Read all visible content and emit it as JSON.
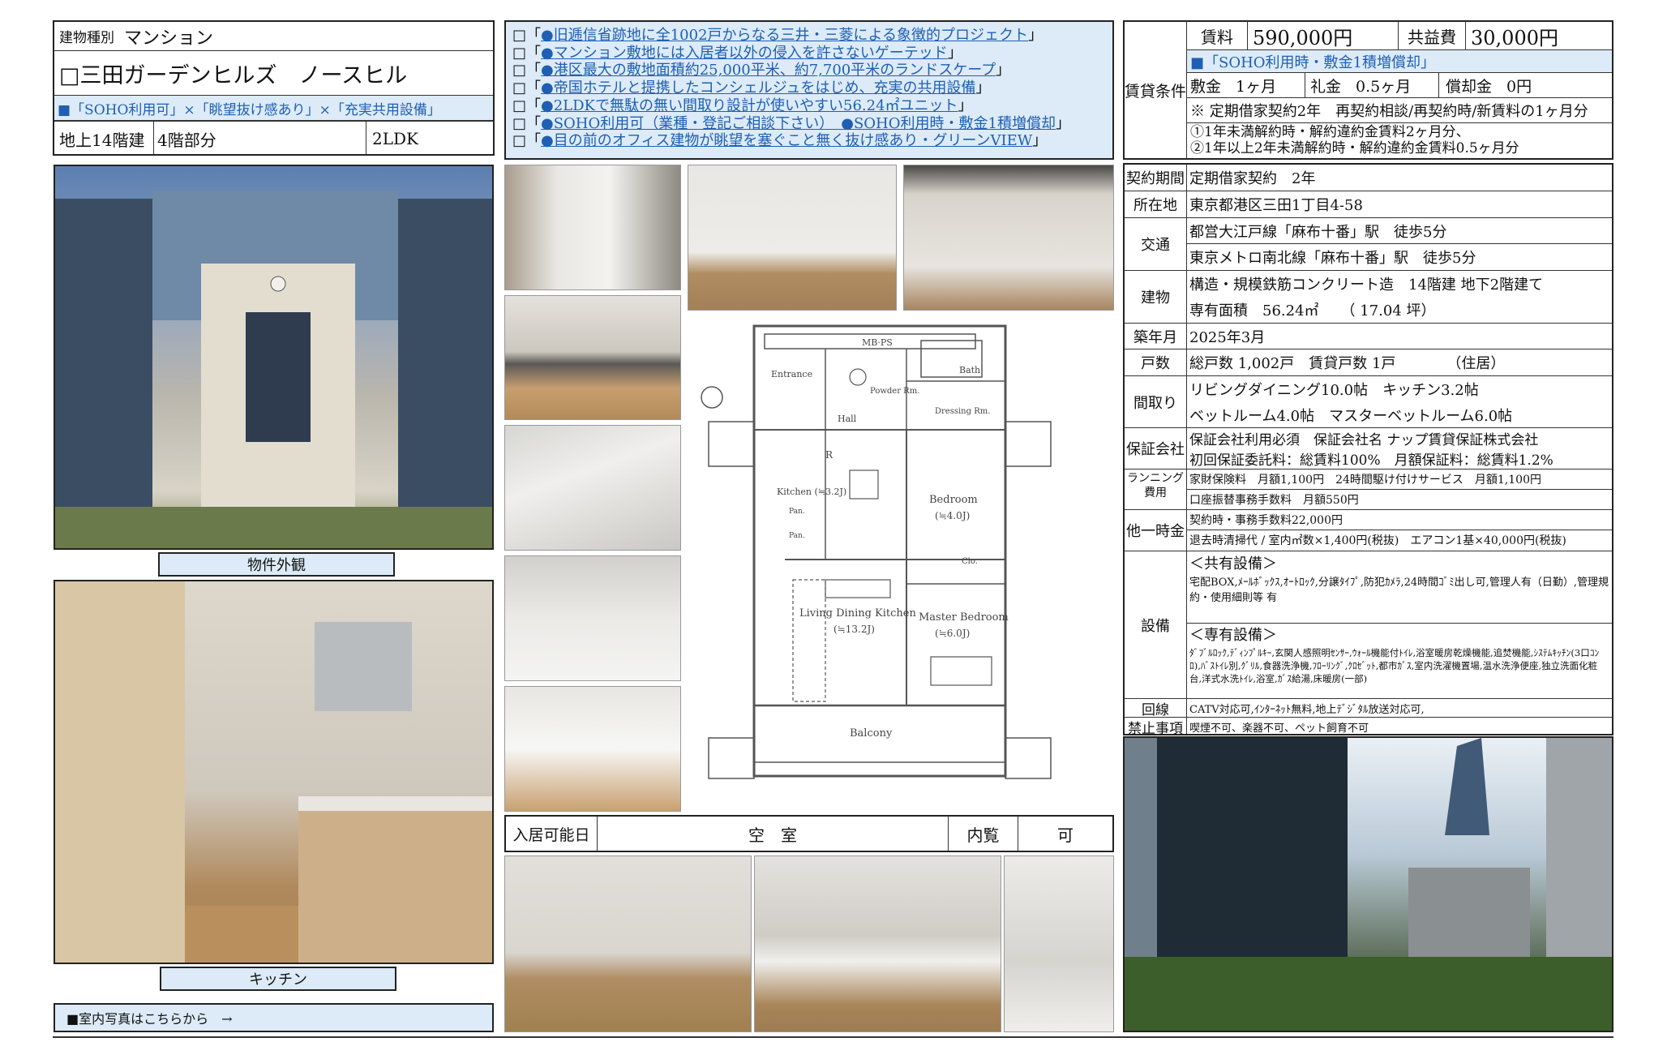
{
  "header": {
    "building_type_label": "建物種別",
    "building_type": "マンション",
    "property_name": "□三田ガーデンヒルズ　ノースヒル",
    "tagline": "■「SOHO利用可」×「眺望抜け感あり」×「充実共用設備」",
    "floors": "地上14階建",
    "unit_floor": "4階部分",
    "layout": "2LDK"
  },
  "features": [
    {
      "prefix": "□「",
      "text": "●旧逓信省跡地に全1002戸からなる三井・三菱による象徴的プロジェクト",
      "suffix": "」"
    },
    {
      "prefix": "□「",
      "text": "●マンション敷地には入居者以外の侵入を許さないゲーテッド",
      "suffix": "」"
    },
    {
      "prefix": "□「",
      "text": "●港区最大の敷地面積約25,000平米、約7,700平米のランドスケープ",
      "suffix": "」"
    },
    {
      "prefix": "□「",
      "text": "●帝国ホテルと提携したコンシェルジュをはじめ、充実の共用設備",
      "suffix": "」"
    },
    {
      "prefix": "□「",
      "text": "●2LDKで無駄の無い間取り設計が使いやすい56.24㎡ユニット",
      "suffix": "」"
    },
    {
      "prefix": "□「",
      "text": "●SOHO利用可（業種・登記ご相談下さい）　●SOHO利用時・敷金1積増償却",
      "suffix": "」"
    },
    {
      "prefix": "□「",
      "text": "●目の前のオフィス建物が眺望を塞ぐこと無く抜け感あり・グリーンVIEW",
      "suffix": "」"
    }
  ],
  "rent": {
    "section_label": "賃貸条件",
    "rent_label": "賃料",
    "rent_value": "590,000円",
    "common_label": "共益費",
    "common_value": "30,000円",
    "soho_note": "■「SOHO利用時・敷金1積増償却」",
    "deposit_label": "敷金",
    "deposit_value": "1ヶ月",
    "key_money_label": "礼金",
    "key_money_value": "0.5ヶ月",
    "amortization_label": "償却金",
    "amortization_value": "0円",
    "contract_note": "※ 定期借家契約2年　再契約相談/再契約時/新賃料の1ヶ月分",
    "penalty_1": "①1年未満解約時・解約違約金賃料2ヶ月分、",
    "penalty_2": "②1年以上2年未満解約時・解約違約金賃料0.5ヶ月分"
  },
  "details": {
    "contract_label": "契約期間",
    "contract_value": "定期借家契約　2年",
    "address_label": "所在地",
    "address_value": "東京都港区三田1丁目4-58",
    "transit_label": "交通",
    "transit_1": "都営大江戸線「麻布十番」駅　徒歩5分",
    "transit_2": "東京メトロ南北線「麻布十番」駅　徒歩5分",
    "building_label": "建物",
    "building_1": "構造・規模鉄筋コンクリート造　14階建 地下2階建て",
    "building_2": "専有面積　56.24㎡　　（ 17.04 坪）",
    "built_label": "築年月",
    "built_value": "2025年3月",
    "units_label": "戸数",
    "units_value": "総戸数 1,002戸　賃貸戸数 1戸　　　　（住居）",
    "rooms_label": "間取り",
    "rooms_1": "リビングダイニング10.0帖　キッチン3.2帖",
    "rooms_2": "ベットルーム4.0帖　マスターベットルーム6.0帖",
    "guarantee_label": "保証会社",
    "guarantee_1": "保証会社利用必須　保証会社名 ナップ賃貸保証株式会社",
    "guarantee_2": "初回保証委託料：総賃料100%　月額保証料：総賃料1.2%",
    "running_label_1": "ランニング",
    "running_label_2": "費用",
    "running_1": "家財保険料　月額1,100円　24時間駆け付けサービス　月額1,100円",
    "running_2": "口座振替事務手数料　月額550円",
    "lump_label": "他一時金",
    "lump_1": "契約時・事務手数料22,000円",
    "lump_2": "退去時清掃代 / 室内㎡数×1,400円(税抜)　エアコン1基×40,000円(税抜)",
    "equipment_label": "設備",
    "shared_heading": "＜共有設備＞",
    "shared_text": "宅配BOX,ﾒｰﾙﾎﾞｯｸｽ,ｵｰﾄﾛｯｸ,分譲ﾀｲﾌﾟ,防犯ｶﾒﾗ,24時間ｺﾞﾐ出し可,管理人有（日勤）,管理規約・使用細則等 有",
    "private_heading": "＜専有設備＞",
    "private_text": "ﾀﾞﾌﾞﾙﾛｯｸ,ﾃﾞｨﾝﾌﾟﾙｷｰ,玄関人感照明ｾﾝｻｰ,ｳｫｰﾙ機能付ﾄｲﾚ,浴室暖房乾燥機能,追焚機能,ｼｽﾃﾑｷｯﾁﾝ(3口ｺﾝﾛ),ﾊﾞｽﾄｲﾚ別,ｸﾞﾘﾙ,食器洗浄機,ﾌﾛｰﾘﾝｸﾞ,ｸﾛｾﾞｯﾄ,都市ｶﾞｽ,室内洗濯機置場,温水洗浄便座,独立洗面化粧台,洋式水洗ﾄｲﾚ,浴室,ｶﾞｽ給湯,床暖房(一部)",
    "line_label": "回線",
    "line_value": "CATV対応可,ｲﾝﾀｰﾈｯﾄ無料,地上ﾃﾞｼﾞﾀﾙ放送対応可,",
    "prohibited_label": "禁止事項",
    "prohibited_value": "喫煙不可、楽器不可、ペット飼育不可"
  },
  "photos": {
    "exterior_caption": "物件外観",
    "kitchen_caption": "キッチン",
    "interior_link": "■室内写真はこちらから　→"
  },
  "move_in": {
    "label": "入居可能日",
    "value": "空　室",
    "viewing_label": "内覧",
    "viewing_value": "可"
  },
  "floorplan": {
    "labels": {
      "mbps": "MB·PS",
      "entrance": "Entrance",
      "powder": "Powder Rm.",
      "bath": "Bath",
      "hall": "Hall",
      "dressing": "Dressing Rm.",
      "r": "R",
      "kitchen": "Kitchen (≒3.2J)",
      "bedroom": "Bedroom",
      "bedroom_size": "(≒4.0J)",
      "ldk": "Living Dining Kitchen",
      "ldk_size": "(≒13.2J)",
      "master": "Master Bedroom",
      "master_size": "(≒6.0J)",
      "balcony": "Balcony",
      "pan1": "Pan.",
      "pan2": "Pan.",
      "clo": "Clo."
    }
  }
}
